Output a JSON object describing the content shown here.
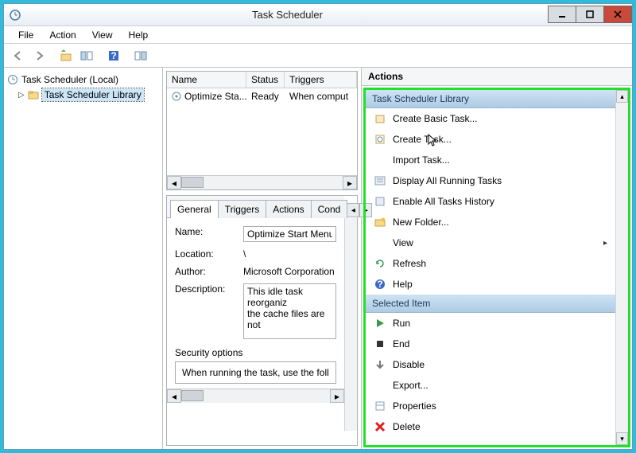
{
  "window": {
    "title": "Task Scheduler"
  },
  "menubar": [
    "File",
    "Action",
    "View",
    "Help"
  ],
  "tree": {
    "root": "Task Scheduler (Local)",
    "child": "Task Scheduler Library"
  },
  "grid": {
    "cols": {
      "name": "Name",
      "status": "Status",
      "triggers": "Triggers"
    },
    "row": {
      "name": "Optimize Sta...",
      "status": "Ready",
      "triggers": "When comput"
    }
  },
  "tabs": [
    "General",
    "Triggers",
    "Actions",
    "Cond"
  ],
  "form": {
    "name_label": "Name:",
    "name_value": "Optimize Start Menu C",
    "location_label": "Location:",
    "location_value": "\\",
    "author_label": "Author:",
    "author_value": "Microsoft Corporation",
    "description_label": "Description:",
    "description_value": "This idle task reorganiz\nthe cache files are not"
  },
  "security": {
    "heading": "Security options",
    "line": "When running the task, use the foll"
  },
  "actions": {
    "pane_title": "Actions",
    "lib_head": "Task Scheduler Library",
    "lib": [
      "Create Basic Task...",
      "Create Task...",
      "Import Task...",
      "Display All Running Tasks",
      "Enable All Tasks History",
      "New Folder...",
      "View",
      "Refresh",
      "Help"
    ],
    "sel_head": "Selected Item",
    "sel": [
      "Run",
      "End",
      "Disable",
      "Export...",
      "Properties",
      "Delete"
    ]
  }
}
